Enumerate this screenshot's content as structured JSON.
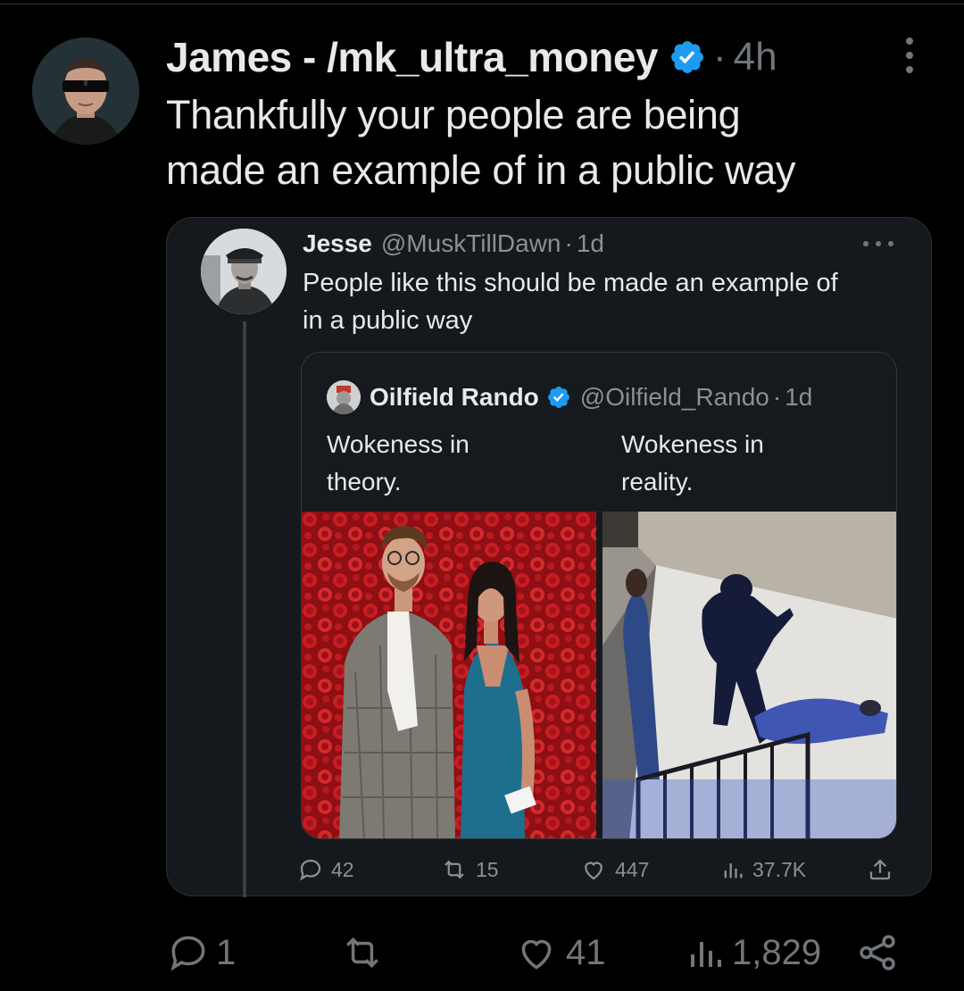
{
  "tweet": {
    "author_name": "James - /mk_ultra_money",
    "separator": "·",
    "time": "4h",
    "text_line1": "Thankfully your people are being",
    "text_line2": "made an example of in a public way",
    "verified_color": "#1d9bf0"
  },
  "quoted": {
    "author_name": "Jesse",
    "handle": "@MuskTillDawn",
    "separator": "·",
    "time": "1d",
    "text_line1": "People like this should be made an example of",
    "text_line2": "in a public way",
    "inner": {
      "author_name": "Oilfield Rando",
      "handle": "@Oilfield_Rando",
      "separator": "·",
      "time": "1d",
      "caption_left_line1": "Wokeness in",
      "caption_left_line2": "theory.",
      "caption_right_line1": "Wokeness in",
      "caption_right_line2": "reality."
    },
    "actions": {
      "replies": "42",
      "reposts": "15",
      "likes": "447",
      "views": "37.7K"
    }
  },
  "actions": {
    "replies": "1",
    "likes": "41",
    "views": "1,829"
  },
  "icons": [
    "more-icon",
    "verified-icon",
    "reply-icon",
    "repost-icon",
    "like-icon",
    "views-icon",
    "share-icon"
  ]
}
